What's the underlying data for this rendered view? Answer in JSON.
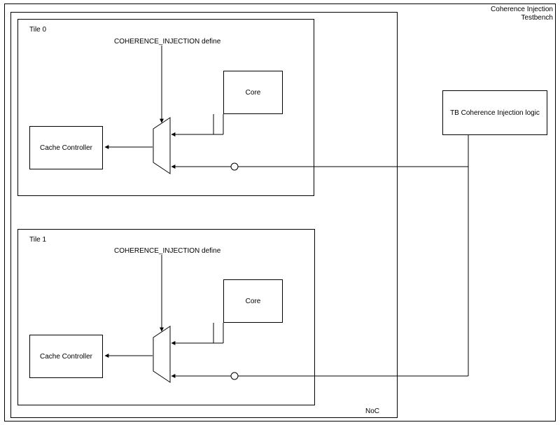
{
  "diagram": {
    "title_line1": "Coherence Injection",
    "title_line2": "Testbench",
    "noc_label": "NoC",
    "tb_box": "TB Coherence Injection logic",
    "tiles": [
      {
        "name": "Tile 0",
        "define_label": "COHERENCE_INJECTION define",
        "core": "Core",
        "cache_controller": "Cache Controller"
      },
      {
        "name": "Tile 1",
        "define_label": "COHERENCE_INJECTION define",
        "core": "Core",
        "cache_controller": "Cache Controller"
      }
    ]
  }
}
